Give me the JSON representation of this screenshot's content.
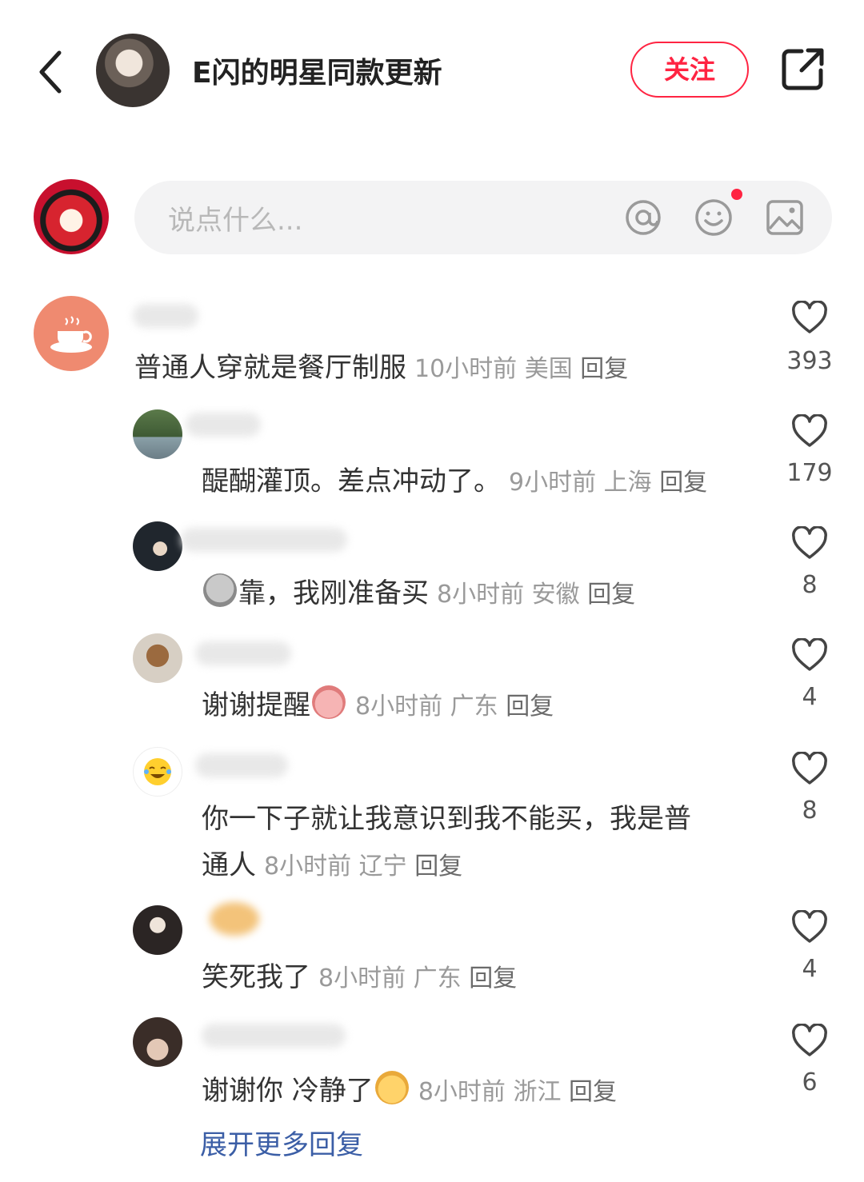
{
  "header": {
    "title": "E闪的明星同款更新",
    "follow_label": "关注"
  },
  "input": {
    "placeholder": "说点什么..."
  },
  "comment": {
    "text": "普通人穿就是餐厅制服",
    "time": "10小时前",
    "location": "美国",
    "reply_label": "回复",
    "likes": "393"
  },
  "replies": [
    {
      "text": "醍醐灌顶。差点冲动了。",
      "time": "9小时前",
      "location": "上海",
      "reply_label": "回复",
      "likes": "179"
    },
    {
      "text": "靠，我刚准备买",
      "time": "8小时前",
      "location": "安徽",
      "reply_label": "回复",
      "likes": "8"
    },
    {
      "text": "谢谢提醒",
      "time": "8小时前",
      "location": "广东",
      "reply_label": "回复",
      "likes": "4"
    },
    {
      "text_line1": "你一下子就让我意识到我不能买，我是普",
      "text_line2": "通人",
      "time": "8小时前",
      "location": "辽宁",
      "reply_label": "回复",
      "likes": "8"
    },
    {
      "text": "笑死我了",
      "time": "8小时前",
      "location": "广东",
      "reply_label": "回复",
      "likes": "4"
    },
    {
      "text": "谢谢你  冷静了",
      "time": "8小时前",
      "location": "浙江",
      "reply_label": "回复",
      "likes": "6"
    }
  ],
  "more_replies_label": "展开更多回复",
  "colors": {
    "accent": "#ff2442",
    "link": "#3b5ea6"
  }
}
